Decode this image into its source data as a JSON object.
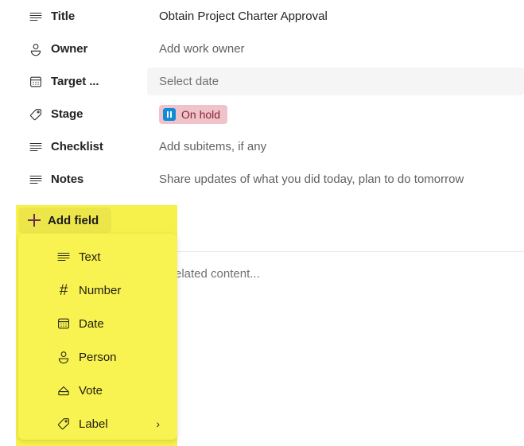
{
  "fields": [
    {
      "icon": "text-lines-icon",
      "label": "Title",
      "value": "Obtain Project Charter Approval",
      "value_kind": "filled"
    },
    {
      "icon": "person-icon",
      "label": "Owner",
      "value": "Add work owner",
      "value_kind": "placeholder"
    },
    {
      "icon": "calendar-icon",
      "label": "Target ...",
      "value": "Select date",
      "value_kind": "date-input"
    },
    {
      "icon": "tag-icon",
      "label": "Stage",
      "value": "On hold",
      "value_kind": "badge"
    },
    {
      "icon": "text-lines-icon",
      "label": "Checklist",
      "value": "Add subitems, if any",
      "value_kind": "placeholder"
    },
    {
      "icon": "text-lines-icon",
      "label": "Notes",
      "value": "Share updates of what you did today, plan to do tomorrow",
      "value_kind": "placeholder"
    }
  ],
  "stage_badge": {
    "label": "On hold",
    "icon": "pause-icon",
    "background": "#eec4ca",
    "text_color": "#8b1f34",
    "icon_background": "#0f8bd7"
  },
  "add_field_button": {
    "label": "Add field",
    "icon": "plus-icon"
  },
  "field_type_menu": {
    "items": [
      {
        "icon": "text-lines-icon",
        "label": "Text",
        "has_submenu": false,
        "chevron": ""
      },
      {
        "icon": "hash-icon",
        "label": "Number",
        "has_submenu": false,
        "chevron": ""
      },
      {
        "icon": "calendar-icon",
        "label": "Date",
        "has_submenu": false,
        "chevron": ""
      },
      {
        "icon": "person-icon",
        "label": "Person",
        "has_submenu": false,
        "chevron": ""
      },
      {
        "icon": "vote-icon",
        "label": "Vote",
        "has_submenu": false,
        "chevron": ""
      },
      {
        "icon": "tag-icon",
        "label": "Label",
        "has_submenu": true,
        "chevron": "›"
      }
    ]
  },
  "related_section": {
    "text": "related content..."
  },
  "colors": {
    "highlight_yellow": "#f7f14b",
    "menu_yellow": "#f9f351",
    "button_yellow": "#ece64b",
    "plus_magenta": "#6b2a4e",
    "date_field_bg": "#f5f5f5",
    "placeholder_text": "#616161",
    "label_text": "#242424"
  }
}
